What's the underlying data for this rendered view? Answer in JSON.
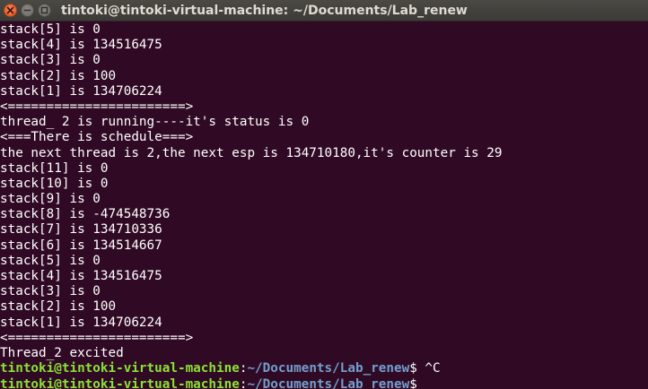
{
  "window": {
    "title": "tintoki@tintoki-virtual-machine: ~/Documents/Lab_renew",
    "buttons": [
      {
        "name": "close",
        "icon": "close-icon"
      },
      {
        "name": "minimize",
        "icon": "minimize-icon"
      },
      {
        "name": "maximize",
        "icon": "maximize-icon"
      }
    ]
  },
  "colors": {
    "background": "#300a24",
    "prompt_user": "#8ae234",
    "prompt_path": "#729fcf",
    "close_button": "#e0501c"
  },
  "terminal": {
    "output": [
      "stack[5] is 0",
      "stack[4] is 134516475",
      "stack[3] is 0",
      "stack[2] is 100",
      "stack[1] is 134706224",
      "<=======================>",
      "thread_ 2 is running----it's status is 0",
      "<===There is schedule===>",
      "the next thread is 2,the next esp is 134710180,it's counter is 29",
      "stack[11] is 0",
      "stack[10] is 0",
      "stack[9] is 0",
      "stack[8] is -474548736",
      "stack[7] is 134710336",
      "stack[6] is 134514667",
      "stack[5] is 0",
      "stack[4] is 134516475",
      "stack[3] is 0",
      "stack[2] is 100",
      "stack[1] is 134706224",
      "<=======================>",
      "Thread_2 excited"
    ],
    "prompts": [
      {
        "user_host": "tintoki@tintoki-virtual-machine",
        "separator": ":",
        "path": "~/Documents/Lab_renew",
        "symbol": "$",
        "command": " ^C"
      },
      {
        "user_host": "tintoki@tintoki-virtual-machine",
        "separator": ":",
        "path": "~/Documents/Lab_renew",
        "symbol": "$",
        "command": ""
      }
    ]
  }
}
